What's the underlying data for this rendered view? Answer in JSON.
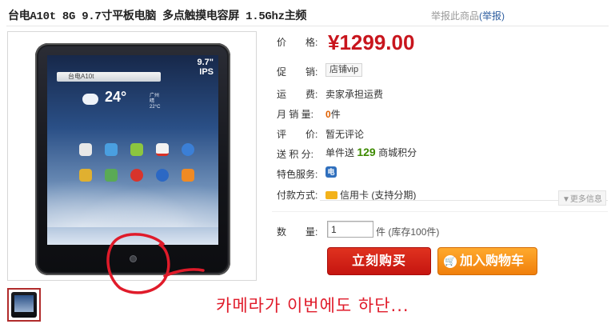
{
  "product": {
    "title": "台电A10t 8G 9.7寸平板电脑 多点触摸电容屏 1.5Ghz主频",
    "report_text": "举报此商品",
    "report_link": "(举报)"
  },
  "gallery": {
    "screen_spec": "9.7\"\nIPS",
    "search_text": "台电A10t",
    "temperature": "24°",
    "weather_text": "广州\n晴\n22°C",
    "annotation_text": "카메라가 이번에도 하단..."
  },
  "attributes": {
    "price_label": "价　　格:",
    "price_value": "¥1299.00",
    "promo_label": "促　　销:",
    "promo_tag": "店铺vip",
    "shipping_label": "运　　费:",
    "shipping_value": "卖家承担运费",
    "sales_label": "月 销 量:",
    "sales_value": "0",
    "sales_unit": "件",
    "review_label": "评　　价:",
    "review_value": "暂无评论",
    "points_label": "送 积 分:",
    "points_prefix": "单件送",
    "points_value": "129",
    "points_suffix": "商城积分",
    "service_label": "特色服务:",
    "service_icon_text": "电",
    "payment_label": "付款方式:",
    "payment_value": "信用卡 (支持分期)",
    "more_info": "▼更多信息"
  },
  "purchase": {
    "qty_label": "数　　量:",
    "qty_value": "1",
    "qty_unit": "件",
    "stock_text": "(库存100件)",
    "buy_label": "立刻购买",
    "cart_label": "加入购物车"
  },
  "colors": {
    "price": "#c8151d",
    "buy_button": "#d2231a",
    "cart_button": "#f7941d",
    "annotation": "#e01b2a"
  }
}
